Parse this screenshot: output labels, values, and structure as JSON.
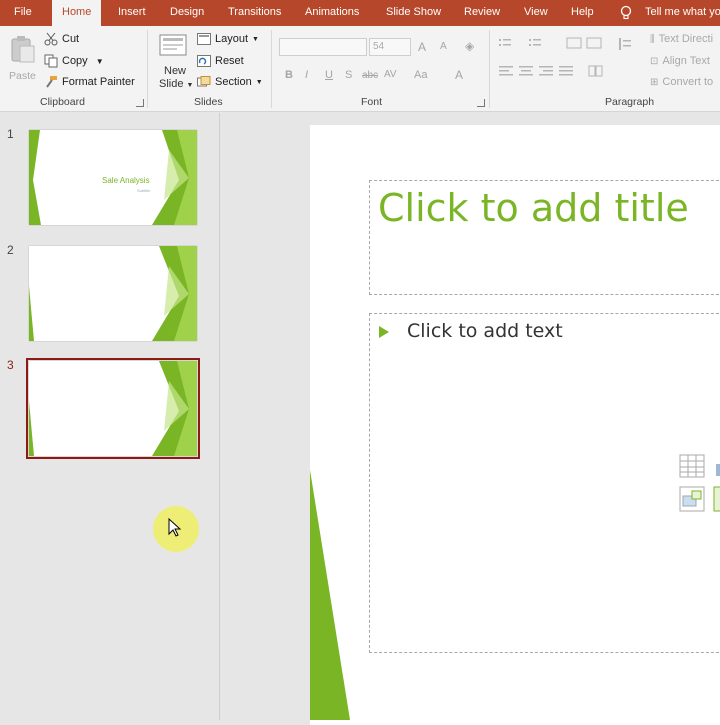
{
  "tabs": [
    {
      "label": "File",
      "active": false
    },
    {
      "label": "Home",
      "active": true
    },
    {
      "label": "Insert",
      "active": false
    },
    {
      "label": "Design",
      "active": false
    },
    {
      "label": "Transitions",
      "active": false
    },
    {
      "label": "Animations",
      "active": false
    },
    {
      "label": "Slide Show",
      "active": false
    },
    {
      "label": "Review",
      "active": false
    },
    {
      "label": "View",
      "active": false
    },
    {
      "label": "Help",
      "active": false
    }
  ],
  "tell_me": "Tell me what yo",
  "ribbon": {
    "clipboard": {
      "label": "Clipboard",
      "paste": "Paste",
      "cut": "Cut",
      "copy": "Copy",
      "format_painter": "Format Painter"
    },
    "slides": {
      "label": "Slides",
      "new_slide_1": "New",
      "new_slide_2": "Slide",
      "layout": "Layout",
      "reset": "Reset",
      "section": "Section"
    },
    "font": {
      "label": "Font",
      "font_name": "",
      "font_size": "54",
      "grow": "A",
      "shrink": "A",
      "bold": "B",
      "italic": "I",
      "underline": "U",
      "shadow": "S",
      "strike": "abc",
      "spacing": "AV",
      "case": "Aa",
      "color": "A"
    },
    "paragraph": {
      "label": "Paragraph",
      "text_direction": "Text Directi",
      "align_text": "Align Text",
      "convert": "Convert to"
    }
  },
  "thumbnails": [
    {
      "number": "1",
      "title": "Sale Analysis",
      "subtitle": "Subtitle"
    },
    {
      "number": "2"
    },
    {
      "number": "3"
    }
  ],
  "slide": {
    "title_placeholder": "Click to add title",
    "body_placeholder": "Click to add text"
  },
  "colors": {
    "accent": "#7ab526",
    "ribbon": "#b7472a",
    "selection": "#8c1c13"
  }
}
